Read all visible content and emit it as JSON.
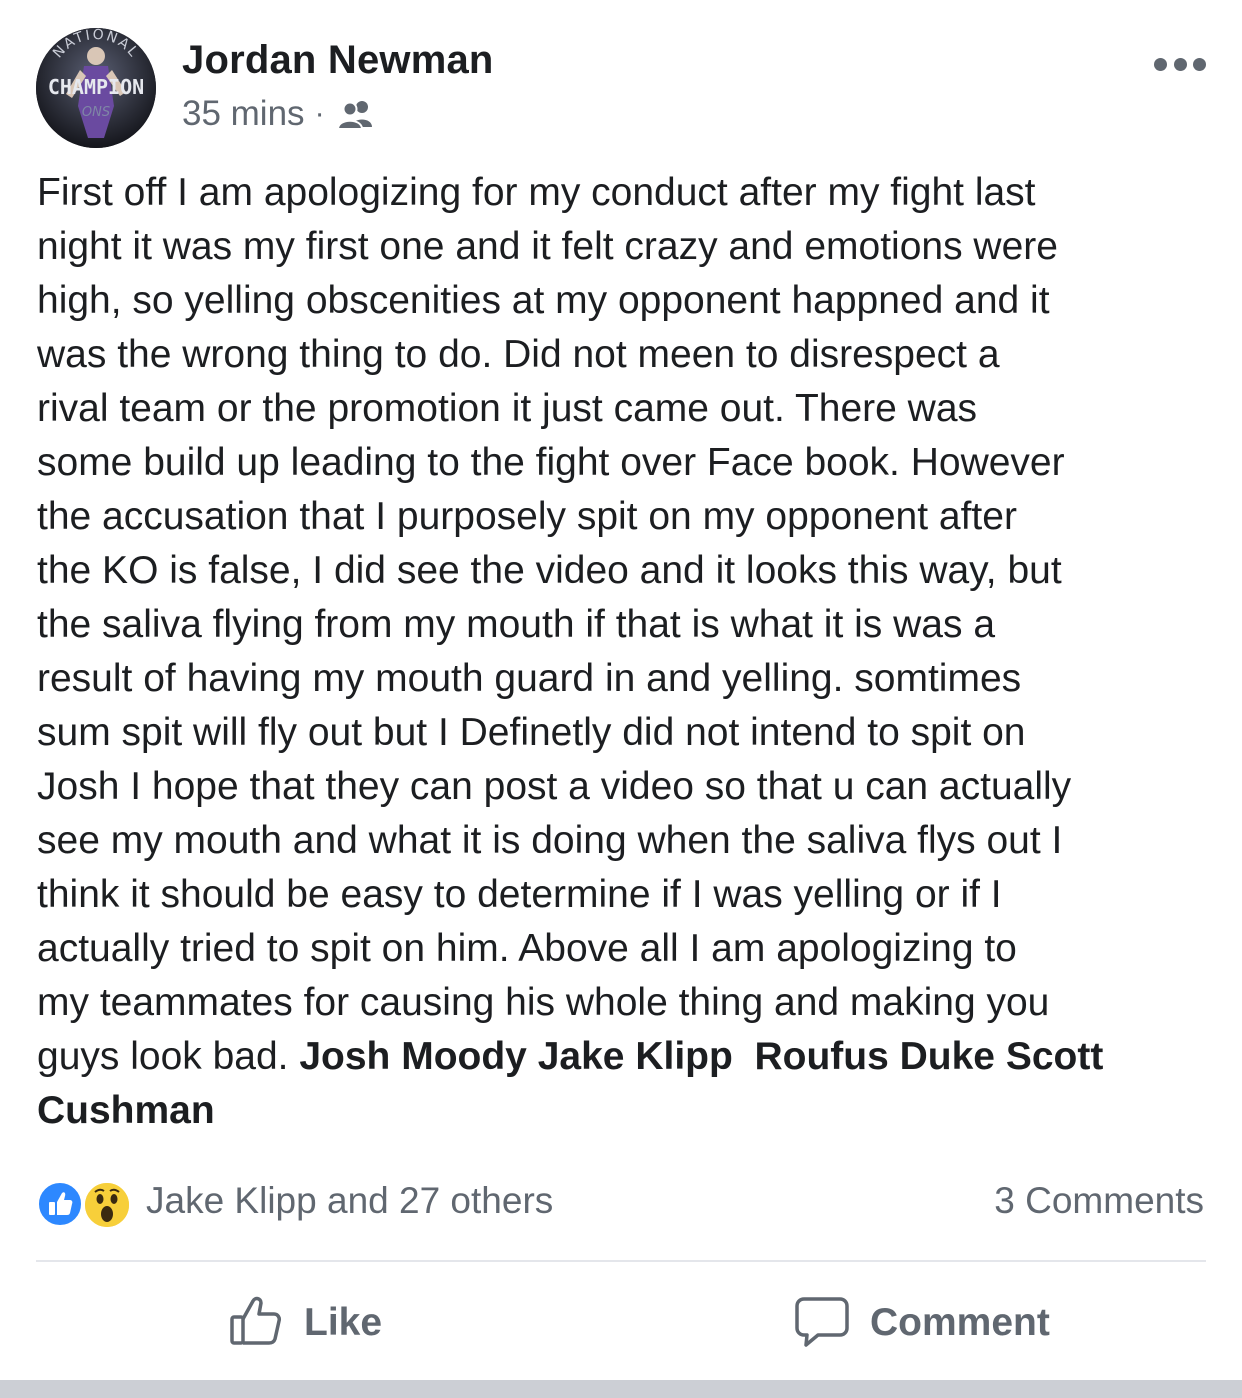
{
  "post": {
    "author": "Jordan Newman",
    "timestamp": "35 mins",
    "separator": "·",
    "audience_icon": "friends-icon",
    "avatar": {
      "arc_text": "NATIONAL",
      "main_text": "CHAMPION",
      "sub_text": "ONS"
    },
    "body_lines": [
      "First off I am apologizing for my conduct after my fight last",
      "night it was my first one and it felt crazy and emotions were",
      "high, so yelling obscenities at my opponent happned and it",
      "was the wrong thing to do. Did not meen to disrespect a",
      "rival team or the promotion it just came out. There was",
      "some build up leading to the fight over Face book. However",
      "the accusation that I purposely spit on my opponent after",
      "the KO is false, I did see the video and it looks this way, but",
      "the saliva flying from my mouth if that is what it is was a",
      "result of having my mouth guard in and yelling. somtimes",
      "sum spit will fly out but I Definetly did not intend to spit on",
      "Josh I hope that they can post a video so that u can actually",
      "see my mouth and what it is doing when the saliva flys out I",
      "think it should be easy to determine if I was yelling or if I",
      "actually tried to spit on him. Above all I am apologizing to",
      "my teammates for causing his whole thing and making you"
    ],
    "last_line_text": "guys look bad.",
    "tags": [
      "Josh Moody",
      "Jake Klipp",
      "Roufus Duke",
      "Scott",
      "Cushman"
    ]
  },
  "reactions": {
    "icons": [
      "like-icon",
      "wow-icon"
    ],
    "summary": "Jake Klipp and 27 others",
    "comments": "3 Comments"
  },
  "actions": {
    "like_label": "Like",
    "comment_label": "Comment"
  },
  "colors": {
    "text": "#1c1e21",
    "secondary": "#606770",
    "like_blue": "#2d88ff",
    "wow_yellow": "#f7cf3a",
    "divider": "#e4e6eb"
  }
}
